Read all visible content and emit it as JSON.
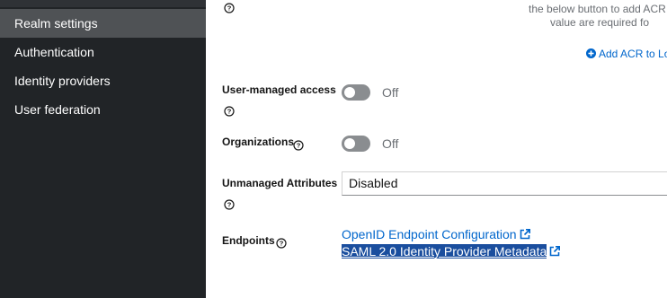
{
  "sidebar": {
    "items": [
      {
        "label": "Realm settings",
        "active": true
      },
      {
        "label": "Authentication",
        "active": false
      },
      {
        "label": "Identity providers",
        "active": false
      },
      {
        "label": "User federation",
        "active": false
      }
    ]
  },
  "acr": {
    "hint_line1": "the below button to add ACR to",
    "hint_line2": "value are required fo",
    "add_link": "Add ACR to Lo"
  },
  "settings": {
    "user_managed_access": {
      "label": "User-managed access",
      "state": "Off"
    },
    "organizations": {
      "label": "Organizations",
      "state": "Off"
    },
    "unmanaged_attributes": {
      "label": "Unmanaged Attributes",
      "value": "Disabled"
    },
    "endpoints": {
      "label": "Endpoints",
      "links": [
        {
          "label": "OpenID Endpoint Configuration"
        },
        {
          "label": "SAML 2.0 Identity Provider Metadata"
        }
      ]
    }
  },
  "colors": {
    "sidebar_bg": "#212427",
    "sidebar_active": "#4f5255",
    "link": "#0066cc",
    "toggle_off": "#8a8d90",
    "selection": "#1a4e9e"
  },
  "icons": {
    "help": "help-icon",
    "add": "plus-circle-icon",
    "external": "external-link-icon"
  }
}
